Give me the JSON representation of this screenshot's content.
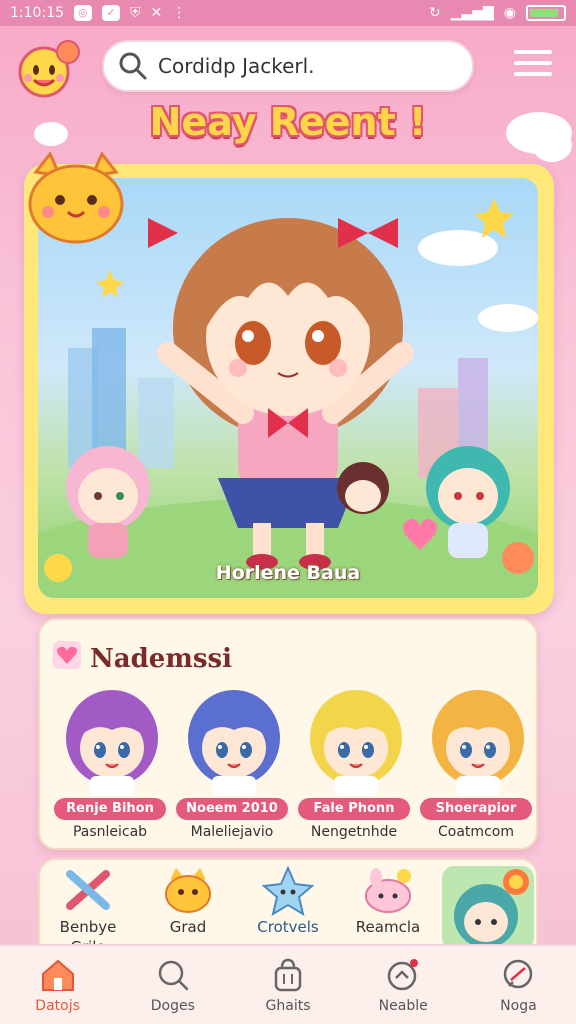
{
  "status_bar": {
    "time": "1:10:15"
  },
  "search": {
    "value": "Cordidp Jackerl."
  },
  "section_title": "Neay Reent !",
  "hero": {
    "caption": "Horlene Baua"
  },
  "characters": {
    "title": "Nademssi",
    "items": [
      {
        "tag": "Renje Bihon",
        "name": "Pasnleicab",
        "hair": "#a25bc4"
      },
      {
        "tag": "Noeem 2010",
        "name": "Maleliejavio",
        "hair": "#5a6fd0"
      },
      {
        "tag": "Fale Phonn",
        "name": "Nengetnhde",
        "hair": "#f2d54a"
      },
      {
        "tag": "Shoerapior",
        "name": "Coatmcom",
        "hair": "#f4b443"
      }
    ]
  },
  "categories": [
    {
      "label": "Benbye",
      "sublabel": "Grilo",
      "icon": "paintbrush-icon"
    },
    {
      "label": "Grad",
      "icon": "cat-face-icon"
    },
    {
      "label": "Crotvels",
      "icon": "star-character-icon"
    },
    {
      "label": "Reamcla",
      "icon": "bunny-icon"
    }
  ],
  "nav": [
    {
      "label": "Datojs",
      "icon": "home-icon",
      "active": true
    },
    {
      "label": "Doges",
      "icon": "search-icon",
      "active": false
    },
    {
      "label": "Ghaits",
      "icon": "bag-icon",
      "active": false
    },
    {
      "label": "Neable",
      "icon": "notification-icon",
      "active": false
    },
    {
      "label": "Noga",
      "icon": "chat-icon",
      "active": false
    }
  ],
  "colors": {
    "accent": "#e35a7c",
    "title_fill": "#ffd54a",
    "title_outline": "#e0566e",
    "status_bar": "#e789b0"
  }
}
